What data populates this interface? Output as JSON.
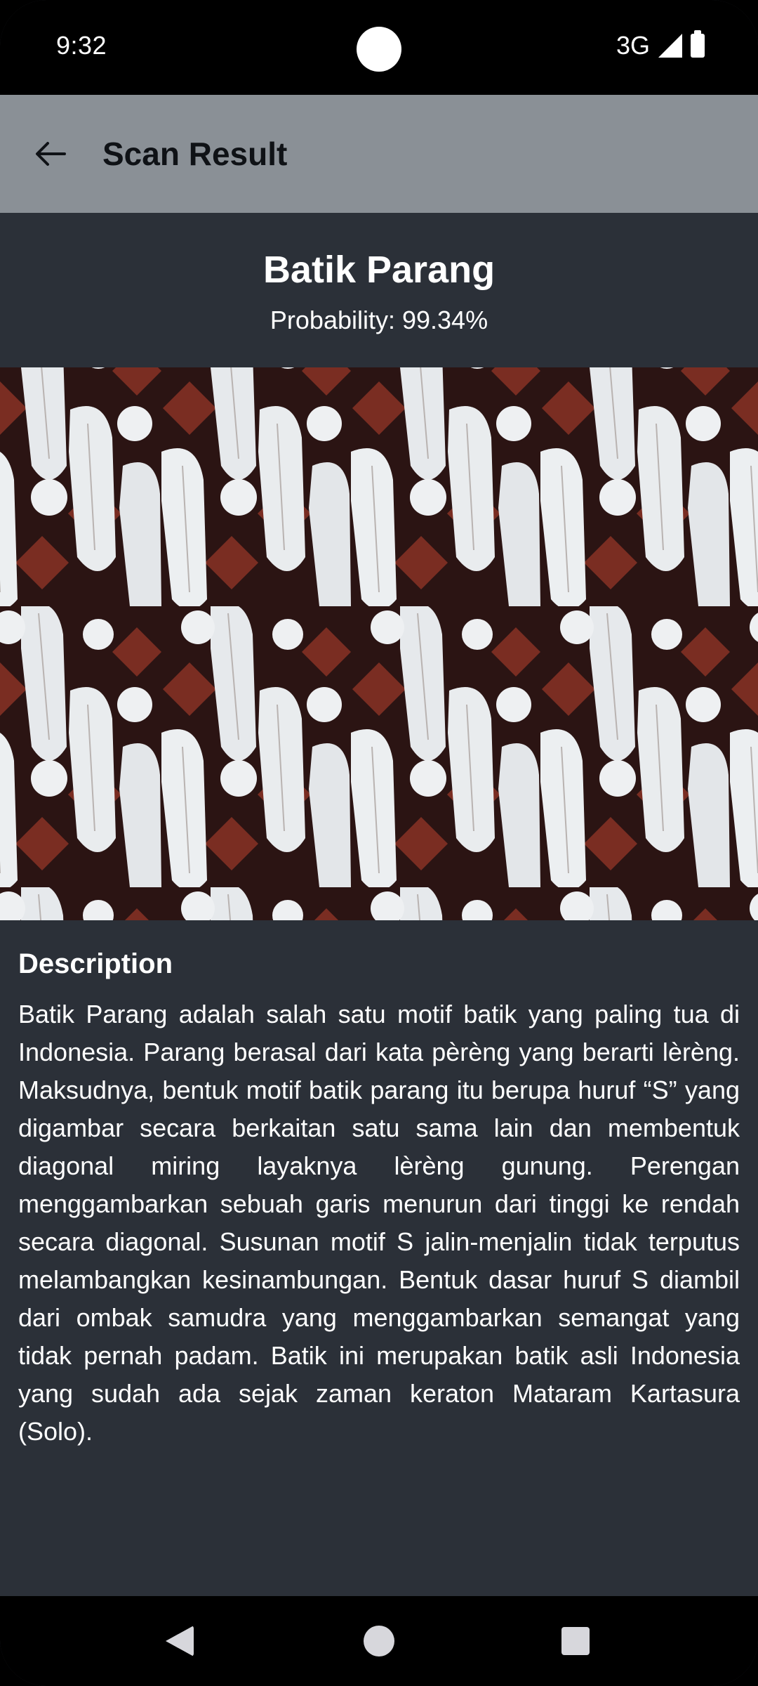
{
  "status_bar": {
    "time": "9:32",
    "network": "3G",
    "icons": [
      "signal-icon",
      "battery-icon"
    ]
  },
  "app_bar": {
    "back_icon": "arrow-left-icon",
    "title": "Scan Result"
  },
  "result": {
    "title": "Batik Parang",
    "probability": "Probability: 99.34%"
  },
  "image": {
    "description_icon": "batik-parang-photo",
    "colors": {
      "light": "#e9ecee",
      "dark": "#2b1413",
      "accent": "#7a2d22"
    }
  },
  "description": {
    "heading": "Description",
    "text": "Batik Parang adalah salah satu motif batik yang paling tua di Indonesia. Parang berasal dari kata pèrèng yang berarti lèrèng. Maksudnya, bentuk motif batik parang itu berupa huruf “S” yang digambar secara berkaitan satu sama lain dan membentuk diagonal miring layaknya lèrèng gunung. Perengan menggambarkan sebuah garis menurun dari tinggi ke rendah secara diagonal. Susunan motif S jalin-menjalin tidak terputus melambangkan kesinambungan. Bentuk dasar huruf S diambil dari ombak samudra yang menggambarkan semangat yang tidak pernah padam. Batik ini merupakan batik asli Indonesia yang sudah ada sejak zaman keraton Mataram Kartasura (Solo)."
  },
  "nav_bar": {
    "icons": [
      "nav-back-icon",
      "nav-home-icon",
      "nav-recents-icon"
    ]
  },
  "theme": {
    "background": "#2b3038",
    "app_bar": "#8a9096",
    "text": "#ffffff"
  }
}
